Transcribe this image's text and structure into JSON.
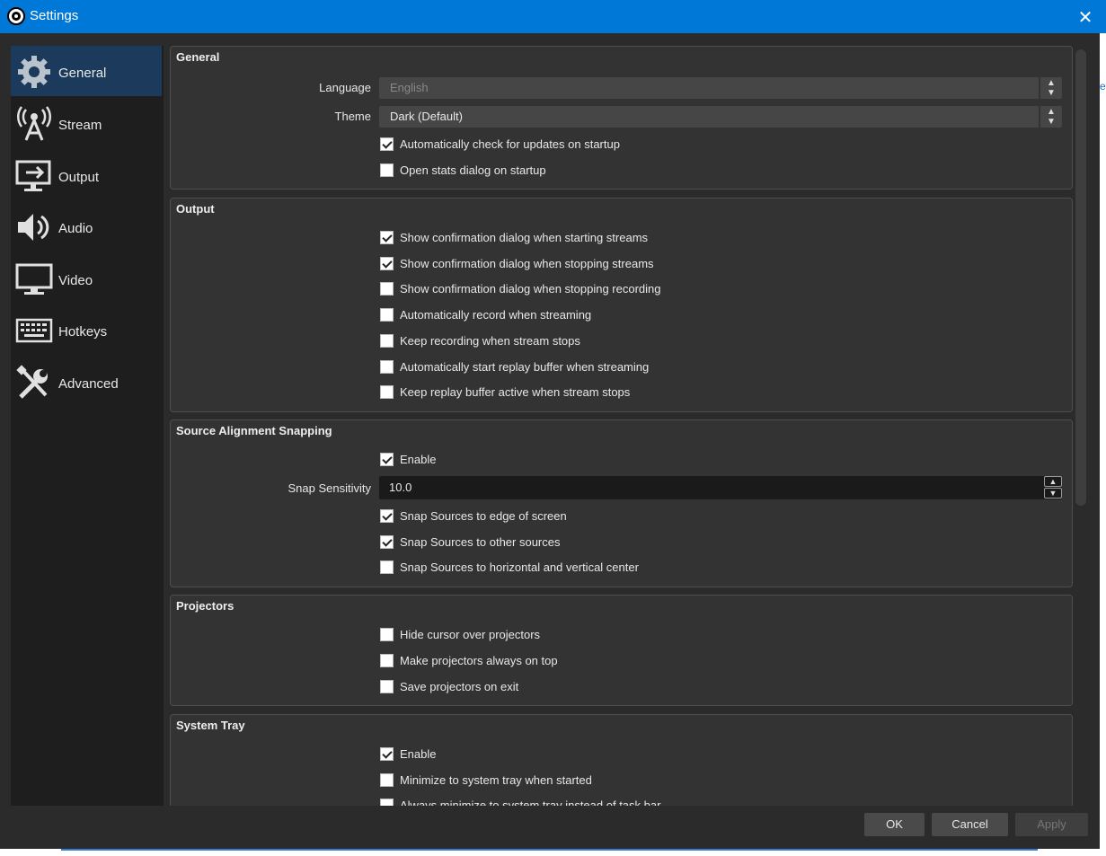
{
  "window": {
    "title": "Settings",
    "close_label": "✕"
  },
  "sidebar": {
    "items": [
      {
        "label": "General",
        "icon": "gear-icon",
        "active": true
      },
      {
        "label": "Stream",
        "icon": "broadcast-icon",
        "active": false
      },
      {
        "label": "Output",
        "icon": "output-icon",
        "active": false
      },
      {
        "label": "Audio",
        "icon": "speaker-icon",
        "active": false
      },
      {
        "label": "Video",
        "icon": "monitor-icon",
        "active": false
      },
      {
        "label": "Hotkeys",
        "icon": "keyboard-icon",
        "active": false
      },
      {
        "label": "Advanced",
        "icon": "tools-icon",
        "active": false
      }
    ]
  },
  "general": {
    "title": "General",
    "language_label": "Language",
    "language_value": "English",
    "theme_label": "Theme",
    "theme_value": "Dark (Default)",
    "checks": [
      {
        "label": "Automatically check for updates on startup",
        "checked": true
      },
      {
        "label": "Open stats dialog on startup",
        "checked": false
      }
    ]
  },
  "output": {
    "title": "Output",
    "checks": [
      {
        "label": "Show confirmation dialog when starting streams",
        "checked": true
      },
      {
        "label": "Show confirmation dialog when stopping streams",
        "checked": true
      },
      {
        "label": "Show confirmation dialog when stopping recording",
        "checked": false
      },
      {
        "label": "Automatically record when streaming",
        "checked": false
      },
      {
        "label": "Keep recording when stream stops",
        "checked": false
      },
      {
        "label": "Automatically start replay buffer when streaming",
        "checked": false
      },
      {
        "label": "Keep replay buffer active when stream stops",
        "checked": false
      }
    ]
  },
  "snapping": {
    "title": "Source Alignment Snapping",
    "enable": {
      "label": "Enable",
      "checked": true
    },
    "sensitivity_label": "Snap Sensitivity",
    "sensitivity_value": "10.0",
    "checks": [
      {
        "label": "Snap Sources to edge of screen",
        "checked": true
      },
      {
        "label": "Snap Sources to other sources",
        "checked": true
      },
      {
        "label": "Snap Sources to horizontal and vertical center",
        "checked": false
      }
    ]
  },
  "projectors": {
    "title": "Projectors",
    "checks": [
      {
        "label": "Hide cursor over projectors",
        "checked": false
      },
      {
        "label": "Make projectors always on top",
        "checked": false
      },
      {
        "label": "Save projectors on exit",
        "checked": false
      }
    ]
  },
  "system_tray": {
    "title": "System Tray",
    "checks": [
      {
        "label": "Enable",
        "checked": true
      },
      {
        "label": "Minimize to system tray when started",
        "checked": false
      },
      {
        "label": "Always minimize to system tray instead of task bar",
        "checked": false
      }
    ]
  },
  "buttons": {
    "ok": "OK",
    "cancel": "Cancel",
    "apply": "Apply"
  },
  "background_fragments": {
    "top": "e"
  },
  "colors": {
    "titlebar": "#0078d7",
    "window_bg": "#2b2b2b",
    "active_nav": "#1b3a5c",
    "group_bg": "#333333"
  }
}
